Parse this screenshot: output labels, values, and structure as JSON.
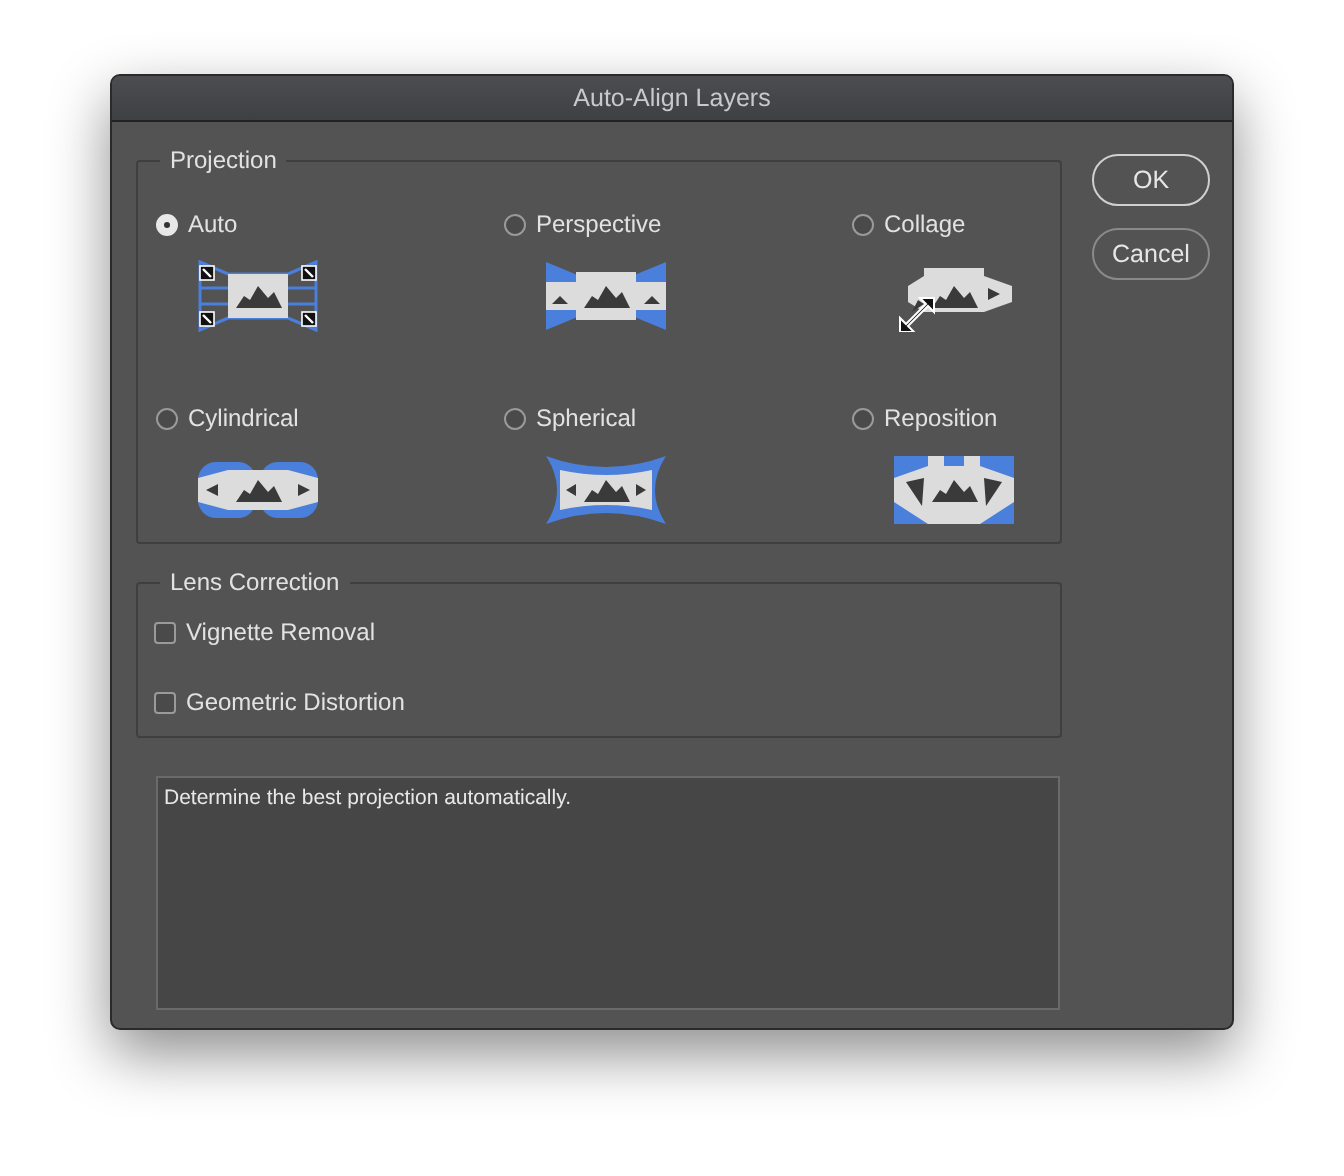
{
  "window": {
    "title": "Auto-Align Layers"
  },
  "projection": {
    "title": "Projection",
    "options": [
      {
        "label": "Auto",
        "kind": "auto",
        "selected": true
      },
      {
        "label": "Perspective",
        "kind": "perspective",
        "selected": false
      },
      {
        "label": "Collage",
        "kind": "collage",
        "selected": false
      },
      {
        "label": "Cylindrical",
        "kind": "cylindrical",
        "selected": false
      },
      {
        "label": "Spherical",
        "kind": "spherical",
        "selected": false
      },
      {
        "label": "Reposition",
        "kind": "reposition",
        "selected": false
      }
    ]
  },
  "lens_correction": {
    "title": "Lens Correction",
    "options": [
      {
        "label": "Vignette Removal",
        "checked": false
      },
      {
        "label": "Geometric Distortion",
        "checked": false
      }
    ]
  },
  "description": "Determine the best projection automatically.",
  "buttons": [
    {
      "label": "OK",
      "default": true
    },
    {
      "label": "Cancel",
      "default": false
    }
  ]
}
